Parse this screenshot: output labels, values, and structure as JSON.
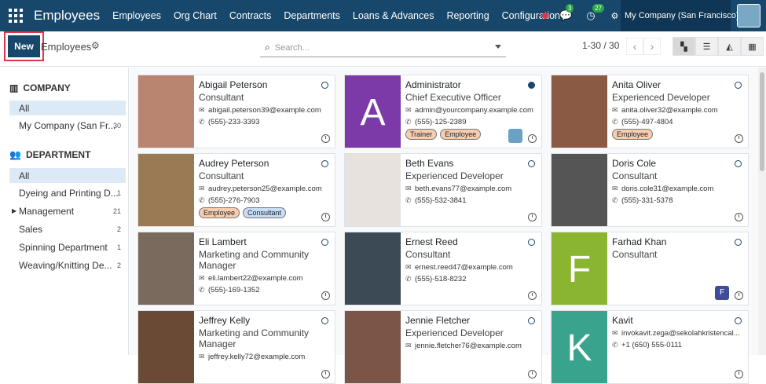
{
  "navbar": {
    "app_title": "Employees",
    "menu": [
      "Employees",
      "Org Chart",
      "Contracts",
      "Departments",
      "Loans & Advances",
      "Reporting",
      "Configuration"
    ],
    "chat_count": "3",
    "activity_count": "27",
    "company": "My Company (San Francisco)"
  },
  "control": {
    "new_label": "New",
    "breadcrumb": "Employees",
    "search_placeholder": "Search...",
    "pager": "1-30 / 30"
  },
  "sidebar": {
    "company_header": "COMPANY",
    "company_items": [
      {
        "label": "All",
        "count": ""
      },
      {
        "label": "My Company (San Fr...",
        "count": "30"
      }
    ],
    "department_header": "DEPARTMENT",
    "department_items": [
      {
        "label": "All",
        "count": ""
      },
      {
        "label": "Dyeing and Printing D...",
        "count": "1"
      },
      {
        "label": "Management",
        "count": "21"
      },
      {
        "label": "Sales",
        "count": "2"
      },
      {
        "label": "Spinning Department",
        "count": "1"
      },
      {
        "label": "Weaving/Knitting De...",
        "count": "2"
      }
    ]
  },
  "employees": [
    {
      "name": "Abigail Peterson",
      "job": "Consultant",
      "email": "abigail.peterson39@example.com",
      "phone": "(555)-233-3393",
      "tags": [],
      "photo": "#b98470",
      "letter": ""
    },
    {
      "name": "Administrator",
      "job": "Chief Executive Officer",
      "email": "admin@yourcompany.example.com",
      "phone": "(555)-125-2389",
      "tags": [
        "Trainer",
        "Employee"
      ],
      "photo": "#7c3aa8",
      "letter": "A"
    },
    {
      "name": "Anita Oliver",
      "job": "Experienced Developer",
      "email": "anita.oliver32@example.com",
      "phone": "(555)-497-4804",
      "tags": [
        "Employee"
      ],
      "photo": "#8a5a45",
      "letter": ""
    },
    {
      "name": "Audrey Peterson",
      "job": "Consultant",
      "email": "audrey.peterson25@example.com",
      "phone": "(555)-276-7903",
      "tags": [
        "Employee",
        "Consultant"
      ],
      "photo": "#9a7a55",
      "letter": ""
    },
    {
      "name": "Beth Evans",
      "job": "Experienced Developer",
      "email": "beth.evans77@example.com",
      "phone": "(555)-532-3841",
      "tags": [],
      "photo": "#e8e2de",
      "letter": ""
    },
    {
      "name": "Doris Cole",
      "job": "Consultant",
      "email": "doris.cole31@example.com",
      "phone": "(555)-331-5378",
      "tags": [],
      "photo": "#555555",
      "letter": ""
    },
    {
      "name": "Eli Lambert",
      "job": "Marketing and Community Manager",
      "email": "eli.lambert22@example.com",
      "phone": "(555)-169-1352",
      "tags": [],
      "photo": "#7a6a5e",
      "letter": ""
    },
    {
      "name": "Ernest Reed",
      "job": "Consultant",
      "email": "ernest.reed47@example.com",
      "phone": "(555)-518-8232",
      "tags": [],
      "photo": "#3c4a55",
      "letter": ""
    },
    {
      "name": "Farhad Khan",
      "job": "Consultant",
      "email": "",
      "phone": "",
      "tags": [],
      "photo": "#8ab531",
      "letter": "F"
    },
    {
      "name": "Jeffrey Kelly",
      "job": "Marketing and Community Manager",
      "email": "jeffrey.kelly72@example.com",
      "phone": "",
      "tags": [],
      "photo": "#6a4a35",
      "letter": ""
    },
    {
      "name": "Jennie Fletcher",
      "job": "Experienced Developer",
      "email": "jennie.fletcher76@example.com",
      "phone": "",
      "tags": [],
      "photo": "#7a5548",
      "letter": ""
    },
    {
      "name": "Kavit",
      "job": "",
      "email": "invokavit.zega@sekolahkristencal...",
      "phone": "+1 (650) 555-0111",
      "tags": [],
      "photo": "#3aa38e",
      "letter": "K"
    }
  ]
}
